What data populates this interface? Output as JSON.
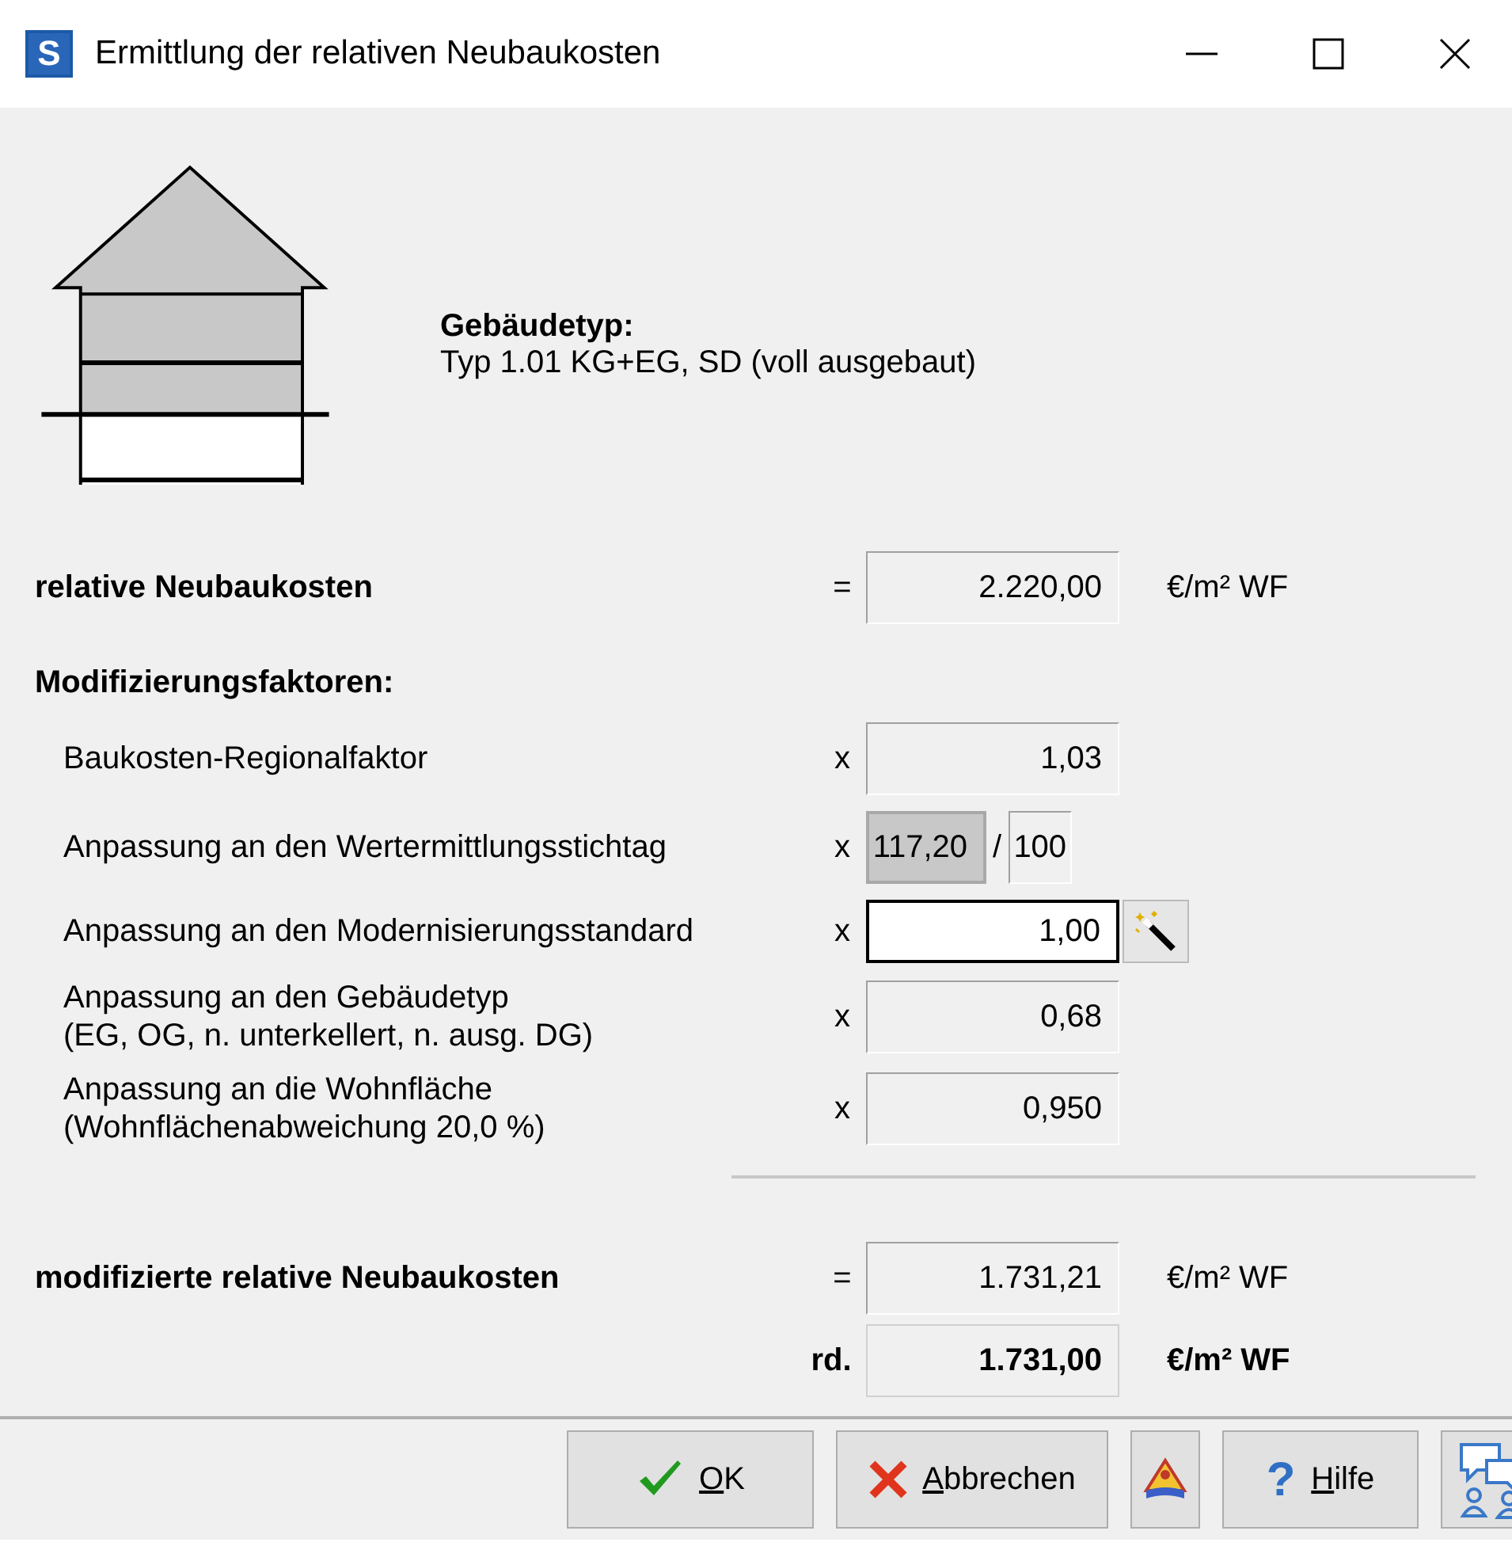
{
  "window": {
    "title": "Ermittlung der relativen Neubaukosten",
    "app_icon": "S"
  },
  "building": {
    "label": "Gebäudetyp:",
    "value": "Typ 1.01 KG+EG, SD (voll ausgebaut)"
  },
  "rows": [
    {
      "kind": "total",
      "label": "relative Neubaukosten",
      "operator": "=",
      "field": {
        "value": "2.220,00",
        "kind": "readonly"
      },
      "unit": "€/m² WF"
    },
    {
      "kind": "heading",
      "label": "Modifizierungsfaktoren:"
    },
    {
      "kind": "factor",
      "label": "Baukosten-Regionalfaktor",
      "operator": "x",
      "field": {
        "value": "1,03",
        "kind": "readonly"
      }
    },
    {
      "kind": "factor",
      "label": "Anpassung an den Wertermittlungsstichtag",
      "operator": "x",
      "field": {
        "value": "117,20",
        "kind": "shaded"
      },
      "divisor": "/",
      "divisor_field": {
        "value": "100",
        "kind": "readonly"
      }
    },
    {
      "kind": "factor",
      "label": "Anpassung an den Modernisierungsstandard",
      "operator": "x",
      "field": {
        "value": "1,00",
        "kind": "editable"
      },
      "wand_button": true
    },
    {
      "kind": "factor",
      "label": "Anpassung an den Gebäudetyp",
      "sublabel": "(EG, OG, n. unterkellert, n. ausg. DG)",
      "operator": "x",
      "field": {
        "value": "0,68",
        "kind": "readonly"
      }
    },
    {
      "kind": "factor",
      "label": "Anpassung an die Wohnfläche",
      "sublabel": "(Wohnflächenabweichung 20,0 %)",
      "operator": "x",
      "field": {
        "value": "0,950",
        "kind": "readonly"
      }
    },
    {
      "kind": "separator"
    },
    {
      "kind": "total",
      "label": "modifizierte relative Neubaukosten",
      "operator": "=",
      "field": {
        "value": "1.731,21",
        "kind": "readonly"
      },
      "unit": "€/m² WF"
    },
    {
      "kind": "rounded",
      "operator": "rd.",
      "field": {
        "value": "1.731,00",
        "kind": "bold"
      },
      "unit": "€/m² WF"
    }
  ],
  "buttons": [
    {
      "kind": "ok",
      "label": "OK"
    },
    {
      "kind": "cancel",
      "label": "Abbrechen"
    },
    {
      "kind": "book"
    },
    {
      "kind": "help",
      "icon": "?",
      "label": "Hilfe"
    },
    {
      "kind": "chat"
    }
  ]
}
